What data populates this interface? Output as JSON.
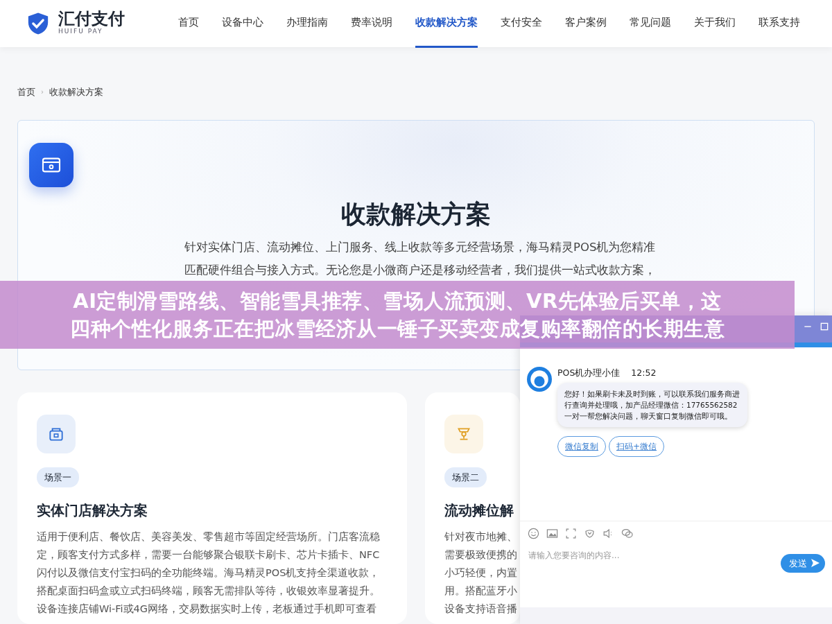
{
  "logo": {
    "name": "汇付支付",
    "subtitle": "HUIFU PAY"
  },
  "nav": [
    {
      "label": "首页",
      "selected": false
    },
    {
      "label": "设备中心",
      "selected": false
    },
    {
      "label": "办理指南",
      "selected": false
    },
    {
      "label": "费率说明",
      "selected": false
    },
    {
      "label": "收款解决方案",
      "selected": true
    },
    {
      "label": "支付安全",
      "selected": false
    },
    {
      "label": "客户案例",
      "selected": false
    },
    {
      "label": "常见问题",
      "selected": false
    },
    {
      "label": "关于我们",
      "selected": false
    },
    {
      "label": "联系支持",
      "selected": false
    }
  ],
  "breadcrumb": [
    "首页",
    "收款解决方案"
  ],
  "breadcrumb_separator": "›",
  "hero": {
    "title": "收款解决方案",
    "lines": [
      "针对实体门店、流动摊位、上门服务、线上收款等多元经营场景，海马精灵POS机为您精准",
      "匹配硬件组合与接入方式。无论您是小微商户还是移动经营者，我们提供一站式收款方案，"
    ]
  },
  "banner": {
    "lines": [
      "AI定制滑雪路线、智能雪具推荐、雪场人流预测、VR先体验后买单，这",
      "四种个性化服务正在把冰雪经济从一锤子买卖变成复购率翻倍的长期生意"
    ]
  },
  "scenarios": [
    {
      "kind": "store",
      "color": "#2f6fd6",
      "tag": "场景一",
      "title": "实体门店解决方案",
      "lines": [
        "适用于便利店、餐饮店、美容美发、零售超市等固定经营场所。门店客流稳",
        "定，顾客支付方式多样，需要一台能够聚合银联卡刷卡、芯片卡插卡、NFC",
        "闪付以及微信支付宝扫码的全功能终端。海马精灵POS机支持全渠道收款，",
        "搭配桌面扫码盒或立式扫码终端，顾客无需排队等待，收银效率显著提升。",
        "设备连接店铺Wi-Fi或4G网络，交易数据实时上传，老板通过手机即可查看"
      ]
    },
    {
      "kind": "stall",
      "color": "#e0a025",
      "tag": "场景二",
      "title": "流动摊位解",
      "lines": [
        "针对夜市地摊、",
        "需要极致便携的",
        "小巧轻便，内置",
        "用。搭配蓝牙小",
        "设备支持语音播"
      ]
    }
  ],
  "chat": {
    "agent": "POS机办理小佳",
    "time": "12:52",
    "message": "您好！如果刷卡未及时到账，可以联系我们服务商进行查询并处理哦，加产品经理微信：17765562582 一对一帮您解决问题，聊天窗口复制微信即可哦。",
    "quick_replies": [
      "微信复制",
      "扫码+微信"
    ],
    "placeholder": "请输入您要咨询的内容...",
    "send": "发送"
  }
}
